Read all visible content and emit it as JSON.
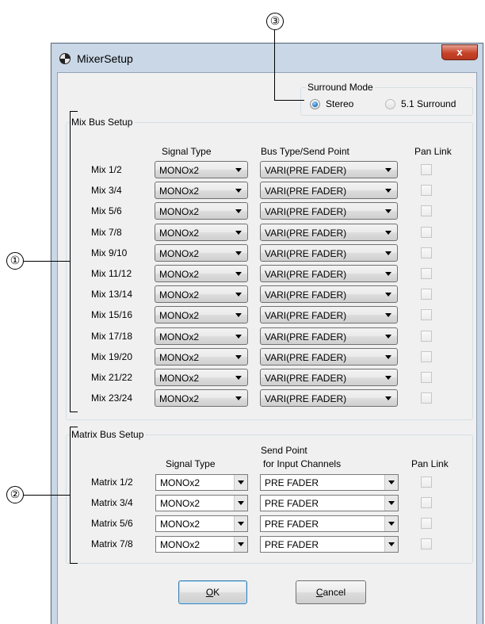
{
  "callouts": [
    "③",
    "①",
    "②"
  ],
  "window": {
    "title": "MixerSetup",
    "close_glyph": "x"
  },
  "surround": {
    "title": "Surround Mode",
    "options": [
      {
        "label": "Stereo",
        "checked": true
      },
      {
        "label": "5.1 Surround",
        "checked": false
      }
    ]
  },
  "mix_bus": {
    "title": "Mix Bus Setup",
    "headers": {
      "signal": "Signal Type",
      "bus": "Bus Type/Send Point",
      "pan": "Pan Link"
    },
    "rows": [
      {
        "label": "Mix 1/2",
        "signal": "MONOx2",
        "bus": "VARI(PRE FADER)",
        "pan_link": false
      },
      {
        "label": "Mix 3/4",
        "signal": "MONOx2",
        "bus": "VARI(PRE FADER)",
        "pan_link": false
      },
      {
        "label": "Mix 5/6",
        "signal": "MONOx2",
        "bus": "VARI(PRE FADER)",
        "pan_link": false
      },
      {
        "label": "Mix 7/8",
        "signal": "MONOx2",
        "bus": "VARI(PRE FADER)",
        "pan_link": false
      },
      {
        "label": "Mix 9/10",
        "signal": "MONOx2",
        "bus": "VARI(PRE FADER)",
        "pan_link": false
      },
      {
        "label": "Mix 11/12",
        "signal": "MONOx2",
        "bus": "VARI(PRE FADER)",
        "pan_link": false
      },
      {
        "label": "Mix 13/14",
        "signal": "MONOx2",
        "bus": "VARI(PRE FADER)",
        "pan_link": false
      },
      {
        "label": "Mix 15/16",
        "signal": "MONOx2",
        "bus": "VARI(PRE FADER)",
        "pan_link": false
      },
      {
        "label": "Mix 17/18",
        "signal": "MONOx2",
        "bus": "VARI(PRE FADER)",
        "pan_link": false
      },
      {
        "label": "Mix 19/20",
        "signal": "MONOx2",
        "bus": "VARI(PRE FADER)",
        "pan_link": false
      },
      {
        "label": "Mix 21/22",
        "signal": "MONOx2",
        "bus": "VARI(PRE FADER)",
        "pan_link": false
      },
      {
        "label": "Mix 23/24",
        "signal": "MONOx2",
        "bus": "VARI(PRE FADER)",
        "pan_link": false
      }
    ]
  },
  "matrix_bus": {
    "title": "Matrix Bus Setup",
    "headers": {
      "signal": "Signal Type",
      "send_line1": "Send Point",
      "send_line2": "for Input Channels",
      "pan": "Pan Link"
    },
    "rows": [
      {
        "label": "Matrix 1/2",
        "signal": "MONOx2",
        "send": "PRE FADER",
        "pan_link": false
      },
      {
        "label": "Matrix 3/4",
        "signal": "MONOx2",
        "send": "PRE FADER",
        "pan_link": false
      },
      {
        "label": "Matrix 5/6",
        "signal": "MONOx2",
        "send": "PRE FADER",
        "pan_link": false
      },
      {
        "label": "Matrix 7/8",
        "signal": "MONOx2",
        "send": "PRE FADER",
        "pan_link": false
      }
    ]
  },
  "buttons": {
    "ok": {
      "mnemonic": "O",
      "rest": "K"
    },
    "cancel": {
      "mnemonic": "C",
      "rest": "ancel"
    }
  },
  "colors": {
    "close_button": "#c7432a",
    "window_frame": "#c9d7e6",
    "dialog_bg": "#f0f0f0"
  },
  "icons": [
    "app-icon",
    "close-icon",
    "chevron-down-icon"
  ]
}
